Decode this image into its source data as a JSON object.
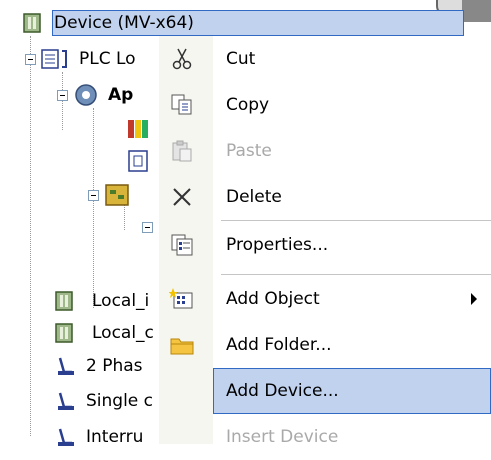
{
  "tree": {
    "device": "Device (MV-x64)",
    "plc_logic": "PLC Lo",
    "application": "Ap",
    "local_in": "Local_i",
    "local_out": "Local_c",
    "two_phase": "2 Phas",
    "single": "Single c",
    "interrupt": "Interru"
  },
  "menu": {
    "items": [
      {
        "label": "Cut",
        "icon": "scissors-icon"
      },
      {
        "label": "Copy",
        "icon": "copy-icon"
      },
      {
        "label": "Paste",
        "icon": "paste-icon",
        "disabled": true
      },
      {
        "label": "Delete",
        "icon": "delete-icon"
      },
      {
        "label": "Properties...",
        "icon": "properties-icon"
      },
      {
        "label": "Add Object",
        "icon": "add-object-icon",
        "submenu": true
      },
      {
        "label": "Add Folder...",
        "icon": "folder-icon"
      },
      {
        "label": "Add Device...",
        "icon": "",
        "highlighted": true
      },
      {
        "label": "Insert Device",
        "icon": "",
        "disabled": true
      }
    ]
  },
  "colors": {
    "highlight": "#c1d2ee",
    "highlight_border": "#316ac5",
    "disabled_text": "#a9a9a9"
  }
}
